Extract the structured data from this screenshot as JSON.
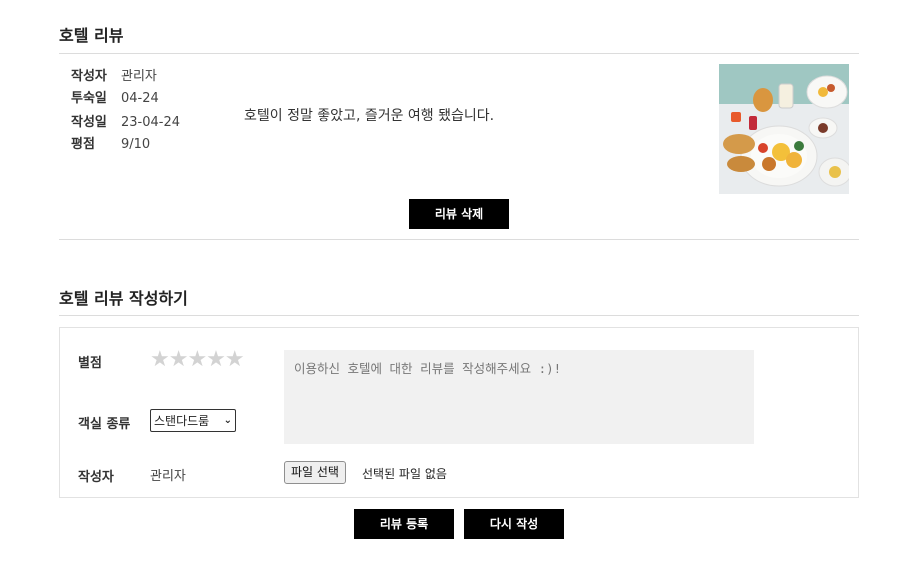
{
  "review_section": {
    "title": "호텔 리뷰",
    "meta": [
      {
        "key": "작성자",
        "value": "관리자"
      },
      {
        "key": "투숙일",
        "value": "04-24"
      },
      {
        "key": "작성일",
        "value": "23-04-24"
      },
      {
        "key": "평점",
        "value": "9/10"
      }
    ],
    "text": "호텔이 정말 좋았고, 즐거운 여행 됐습니다.",
    "delete_label": "리뷰 삭제"
  },
  "write_section": {
    "title": "호텔 리뷰 작성하기",
    "rating_label": "별점",
    "stars": "★★★★★",
    "room_label": "객실 종류",
    "room_selected": "스탠다드룸",
    "review_placeholder": "이용하신 호텔에 대한 리뷰를 작성해주세요 :)!",
    "author_label": "작성자",
    "author_value": "관리자",
    "file_button": "파일 선택",
    "file_status": "선택된 파일 없음",
    "submit_label": "리뷰 등록",
    "reset_label": "다시 작성"
  },
  "colors": {
    "button_bg": "#000000",
    "star_empty": "#d3d3d3",
    "textarea_bg": "#f1f1f1"
  }
}
